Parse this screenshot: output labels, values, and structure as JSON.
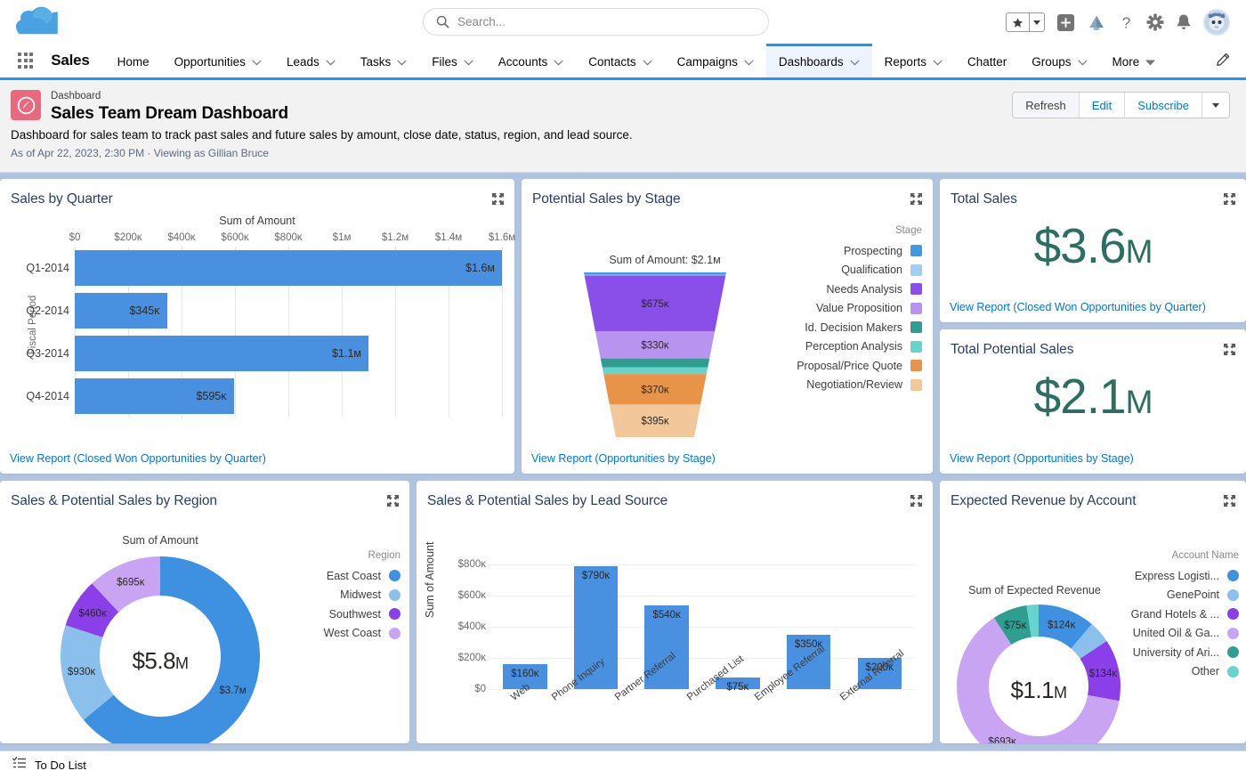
{
  "header": {
    "logo_icon": "salesforce-cloud-logo",
    "search": {
      "placeholder": "Search...",
      "value": "",
      "icon": "search-icon"
    },
    "icons": [
      {
        "name": "favorites-star-icon",
        "glyph": "star"
      },
      {
        "name": "favorites-dropdown-icon",
        "glyph": "caret"
      },
      {
        "name": "add-icon",
        "glyph": "plus"
      },
      {
        "name": "setup-assistant-icon",
        "glyph": "trailhead"
      },
      {
        "name": "help-icon",
        "glyph": "question"
      },
      {
        "name": "setup-gear-icon",
        "glyph": "gear"
      },
      {
        "name": "notifications-bell-icon",
        "glyph": "bell"
      },
      {
        "name": "user-avatar",
        "glyph": "avatar"
      }
    ]
  },
  "nav": {
    "app_launcher_icon": "app-launcher-waffle-icon",
    "app_name": "Sales",
    "items": [
      {
        "label": "Home",
        "has_dropdown": false,
        "active": false
      },
      {
        "label": "Opportunities",
        "has_dropdown": true,
        "active": false
      },
      {
        "label": "Leads",
        "has_dropdown": true,
        "active": false
      },
      {
        "label": "Tasks",
        "has_dropdown": true,
        "active": false
      },
      {
        "label": "Files",
        "has_dropdown": true,
        "active": false
      },
      {
        "label": "Accounts",
        "has_dropdown": true,
        "active": false
      },
      {
        "label": "Contacts",
        "has_dropdown": true,
        "active": false
      },
      {
        "label": "Campaigns",
        "has_dropdown": true,
        "active": false
      },
      {
        "label": "Dashboards",
        "has_dropdown": true,
        "active": true
      },
      {
        "label": "Reports",
        "has_dropdown": true,
        "active": false
      },
      {
        "label": "Chatter",
        "has_dropdown": false,
        "active": false
      },
      {
        "label": "Groups",
        "has_dropdown": true,
        "active": false
      },
      {
        "label": "More",
        "has_dropdown": true,
        "active": false
      }
    ],
    "edit_icon": "pencil-edit-icon"
  },
  "dashboard": {
    "icon": "dashboard-icon",
    "eyebrow": "Dashboard",
    "title": "Sales Team Dream Dashboard",
    "description": "Dashboard for sales team to track past sales and future sales by amount, close date, status, region, and lead source.",
    "meta": "As of Apr 22, 2023, 2:30 PM · Viewing as Gillian Bruce",
    "actions": [
      {
        "label": "Refresh",
        "name": "refresh-button"
      },
      {
        "label": "Edit",
        "name": "edit-button"
      },
      {
        "label": "Subscribe",
        "name": "subscribe-button"
      }
    ],
    "actions_caret_icon": "caret-down-icon"
  },
  "cards": {
    "sales_by_quarter": {
      "title": "Sales by Quarter",
      "expand_icon": "expand-icon",
      "view_report": "View Report (Closed Won Opportunities by Quarter)"
    },
    "potential_by_stage": {
      "title": "Potential Sales by Stage",
      "expand_icon": "expand-icon",
      "view_report": "View Report (Opportunities by Stage)"
    },
    "total_sales": {
      "title": "Total Sales",
      "value": "$3.6",
      "suffix": "M",
      "expand_icon": "expand-icon",
      "view_report": "View Report (Closed Won Opportunities by Quarter)"
    },
    "total_potential_sales": {
      "title": "Total Potential Sales",
      "value": "$2.1",
      "suffix": "M",
      "expand_icon": "expand-icon",
      "view_report": "View Report (Opportunities by Stage)"
    },
    "sales_by_region": {
      "title": "Sales & Potential Sales by Region",
      "expand_icon": "expand-icon"
    },
    "sales_by_lead_source": {
      "title": "Sales & Potential Sales by Lead Source",
      "expand_icon": "expand-icon"
    },
    "expected_revenue_by_account": {
      "title": "Expected Revenue by Account",
      "expand_icon": "expand-icon"
    }
  },
  "footer": {
    "icon": "todo-list-icon",
    "label": "To Do List"
  },
  "chart_data": [
    {
      "id": "sales_by_quarter",
      "type": "bar",
      "orientation": "horizontal",
      "title": "Sales by Quarter",
      "axis_title": "Sum of Amount",
      "ylabel": "Fiscal Period",
      "categories": [
        "Q1-2014",
        "Q2-2014",
        "Q3-2014",
        "Q4-2014"
      ],
      "values": [
        1600000,
        345000,
        1100000,
        595000
      ],
      "labels": [
        "$1.6ᴍ",
        "$345ᴋ",
        "$1.1ᴍ",
        "$595ᴋ"
      ],
      "tick_labels": [
        "$0",
        "$200ᴋ",
        "$400ᴋ",
        "$600ᴋ",
        "$800ᴋ",
        "$1ᴍ",
        "$1.2ᴍ",
        "$1.4ᴍ",
        "$1.6ᴍ"
      ],
      "tick_values": [
        0,
        200000,
        400000,
        600000,
        800000,
        1000000,
        1200000,
        1400000,
        1600000
      ],
      "xlim": [
        0,
        1600000
      ],
      "color": "#4a90e0",
      "grid": true
    },
    {
      "id": "potential_by_stage",
      "type": "funnel",
      "title": "Potential Sales by Stage",
      "subtitle": "Sum of Amount: $2.1ᴍ",
      "total": 2100000,
      "legend_title": "Stage",
      "legend_position": "right",
      "segments": [
        {
          "name": "Prospecting",
          "value": 30000,
          "label": "",
          "color": "#3e9bdf"
        },
        {
          "name": "Qualification",
          "value": 8000,
          "label": "",
          "color": "#9fd0f2"
        },
        {
          "name": "Needs Analysis",
          "value": 675000,
          "label": "$675ᴋ",
          "color": "#8a4fe8"
        },
        {
          "name": "Value Proposition",
          "value": 330000,
          "label": "$330ᴋ",
          "color": "#b894f0"
        },
        {
          "name": "Id. Decision Makers",
          "value": 110000,
          "label": "",
          "color": "#2e9e91"
        },
        {
          "name": "Perception Analysis",
          "value": 80000,
          "label": "",
          "color": "#66d4cc"
        },
        {
          "name": "Proposal/Price Quote",
          "value": 370000,
          "label": "$370ᴋ",
          "color": "#e89448"
        },
        {
          "name": "Negotiation/Review",
          "value": 395000,
          "label": "$395ᴋ",
          "color": "#f2c79a"
        }
      ]
    },
    {
      "id": "sales_by_region",
      "type": "pie",
      "variant": "donut",
      "title": "Sales & Potential Sales by Region",
      "subtitle": "Sum of Amount",
      "center_value": "$5.8",
      "center_suffix": "M",
      "total": 5785000,
      "legend_title": "Region",
      "legend_position": "right",
      "segments": [
        {
          "name": "East Coast",
          "value": 3700000,
          "label": "$3.7ᴍ",
          "color": "#3e90e0"
        },
        {
          "name": "Midwest",
          "value": 930000,
          "label": "$930ᴋ",
          "color": "#8cc0ec"
        },
        {
          "name": "Southwest",
          "value": 460000,
          "label": "$460ᴋ",
          "color": "#8a3fe8"
        },
        {
          "name": "West Coast",
          "value": 695000,
          "label": "$695ᴋ",
          "color": "#c9a4f2"
        }
      ]
    },
    {
      "id": "sales_by_lead_source",
      "type": "bar",
      "orientation": "vertical",
      "title": "Sales & Potential Sales by Lead Source",
      "ylabel": "Sum of Amount",
      "categories": [
        "Web",
        "Phone Inquiry",
        "Partner Referral",
        "Purchased List",
        "Employee Referral",
        "External Referral"
      ],
      "values": [
        160000,
        790000,
        540000,
        75000,
        350000,
        200000
      ],
      "labels": [
        "$160ᴋ",
        "$790ᴋ",
        "$540ᴋ",
        "$75ᴋ",
        "$350ᴋ",
        "$200ᴋ"
      ],
      "tick_labels": [
        "$0",
        "$200ᴋ",
        "$400ᴋ",
        "$600ᴋ",
        "$800ᴋ"
      ],
      "tick_values": [
        0,
        200000,
        400000,
        600000,
        800000
      ],
      "ylim": [
        0,
        800000
      ],
      "color": "#4a90e0",
      "grid": true
    },
    {
      "id": "expected_revenue_by_account",
      "type": "pie",
      "variant": "donut",
      "title": "Expected Revenue by Account",
      "subtitle": "Sum of Expected Revenue",
      "center_value": "$1.1",
      "center_suffix": "M",
      "total": 1100000,
      "legend_title": "Account Name",
      "legend_position": "right",
      "segments": [
        {
          "name": "Express Logisti...",
          "value": 124000,
          "label": "$124ᴋ",
          "color": "#3e90e0"
        },
        {
          "name": "GenePoint",
          "value": 48000,
          "label": "",
          "color": "#8cc0ec"
        },
        {
          "name": "Grand Hotels & ...",
          "value": 134000,
          "label": "$134ᴋ",
          "color": "#8a3fe8"
        },
        {
          "name": "United Oil & Ga...",
          "value": 693000,
          "label": "$693ᴋ",
          "color": "#c9a4f2"
        },
        {
          "name": "University of Ari...",
          "value": 75000,
          "label": "$75ᴋ",
          "color": "#2e9e91"
        },
        {
          "name": "Other",
          "value": 26000,
          "label": "",
          "color": "#66d4cc"
        }
      ]
    }
  ]
}
